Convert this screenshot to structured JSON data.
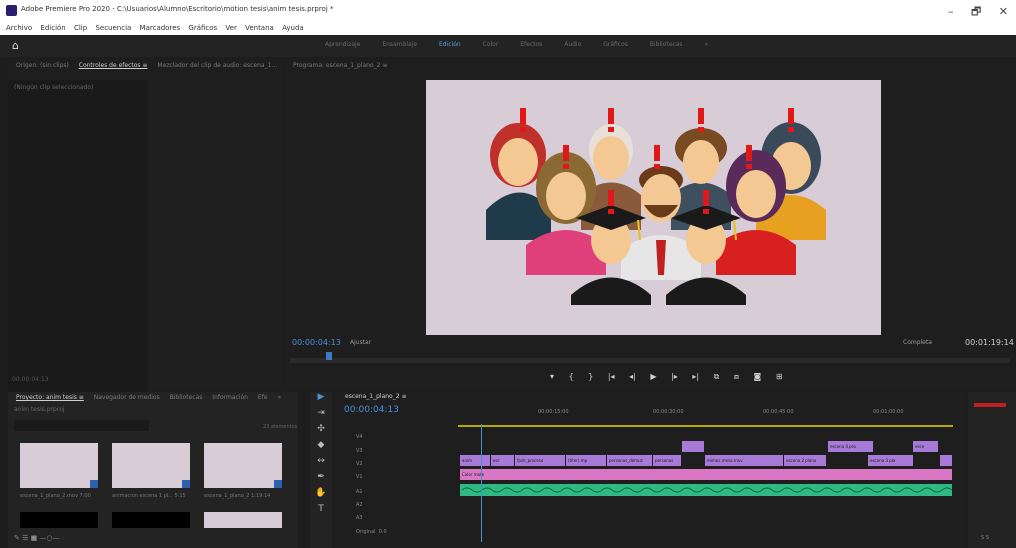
{
  "window": {
    "title": "Adobe Premiere Pro 2020 - C:\\Usuarios\\Alumno\\Escritorio\\motion tesis\\anim tesis.prproj *",
    "controls": [
      "–",
      "🗗",
      "✕"
    ]
  },
  "menu": [
    "Archivo",
    "Edición",
    "Clip",
    "Secuencia",
    "Marcadores",
    "Gráficos",
    "Ver",
    "Ventana",
    "Ayuda"
  ],
  "workspaces": {
    "items": [
      "Aprendizaje",
      "Ensamblaje",
      "Edición",
      "Color",
      "Efectos",
      "Audio",
      "Gráficos",
      "Bibliotecas",
      "»"
    ],
    "active_index": 2
  },
  "source_panel": {
    "tabs": [
      "Origen: (sin clips)",
      "Controles de efectos ≡",
      "Mezclador del clip de audio: escena_1...",
      "»"
    ],
    "active_tab": 1,
    "row": "(Ningún clip seleccionado)",
    "timecode": "00:00:04:13"
  },
  "program_panel": {
    "tab": "Programa: escena_1_plano_2 ≡",
    "timecode": "00:00:04:13",
    "fit": "Ajustar",
    "quality": "Completa",
    "duration": "00:01:19:14"
  },
  "project_panel": {
    "tabs": [
      "Proyecto: anim tesis ≡",
      "Navegador de medios",
      "Bibliotecas",
      "Información",
      "Efe",
      "»"
    ],
    "file": "anim tesis.prproj",
    "items_count": "23 elementos",
    "items": [
      {
        "name": "escena_1_plano_2.mov",
        "duration": "7:00"
      },
      {
        "name": "animacion escena 1 pl...",
        "duration": "5:15"
      },
      {
        "name": "escena_1_plano_2",
        "duration": "1:19:14"
      }
    ]
  },
  "timeline": {
    "tab": "escena_1_plano_2 ≡",
    "timecode": "00:00:04:13",
    "ruler": [
      "00:00:15:00",
      "00:00:30:00",
      "00:00:45:00",
      "00:01:00:00"
    ],
    "tracks": [
      "V4",
      "V3",
      "V2",
      "V1",
      "A1",
      "A2",
      "A3"
    ],
    "master": "Original",
    "master_value": "0.0",
    "clips_v1": [
      "Color mate"
    ],
    "clips_v2": [
      "anim",
      "esc",
      "fpds_proceso",
      "(titer).mp",
      "personas_demuz",
      "personas",
      "mimos mesa.mov",
      "escena 2 plano",
      "escena 3 pla"
    ],
    "clips_v3": [
      "escena 4.pro",
      "esce"
    ]
  },
  "meter": {
    "foot": "S   S"
  },
  "icons": {
    "home": "home-icon",
    "transport": [
      "marker-icon",
      "mark-in-icon",
      "mark-out-icon",
      "go-to-in-icon",
      "step-back-icon",
      "play-icon",
      "step-forward-icon",
      "go-to-out-icon",
      "lift-icon",
      "extract-icon",
      "camera-icon",
      "button-editor-icon"
    ]
  }
}
